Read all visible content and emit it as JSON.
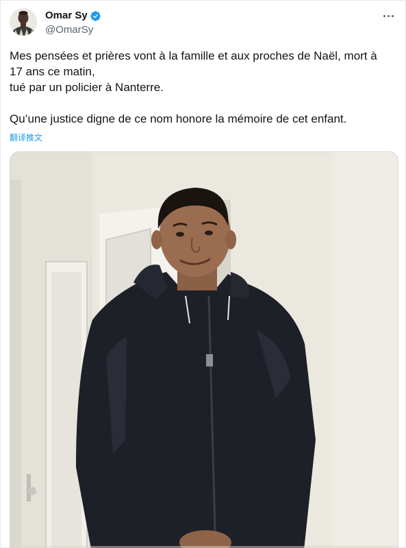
{
  "author": {
    "display_name": "Omar Sy",
    "handle": "@OmarSy",
    "verified": true
  },
  "tweet": {
    "paragraph_1": "Mes pensées et prières vont à la famille et aux proches de Naël, mort à\n17 ans ce matin,\ntué par un policier à Nanterre.",
    "paragraph_2": "Qu’une justice digne de ce nom honore la mémoire de cet enfant.",
    "translate_label": "翻译推文"
  },
  "icons": {
    "verified": "verified-badge-icon",
    "more": "more-options-icon"
  },
  "colors": {
    "text": "#0f1419",
    "secondary": "#536471",
    "link": "#1d9bf0",
    "verified": "#1d9bf0",
    "border": "#cfd9de"
  }
}
